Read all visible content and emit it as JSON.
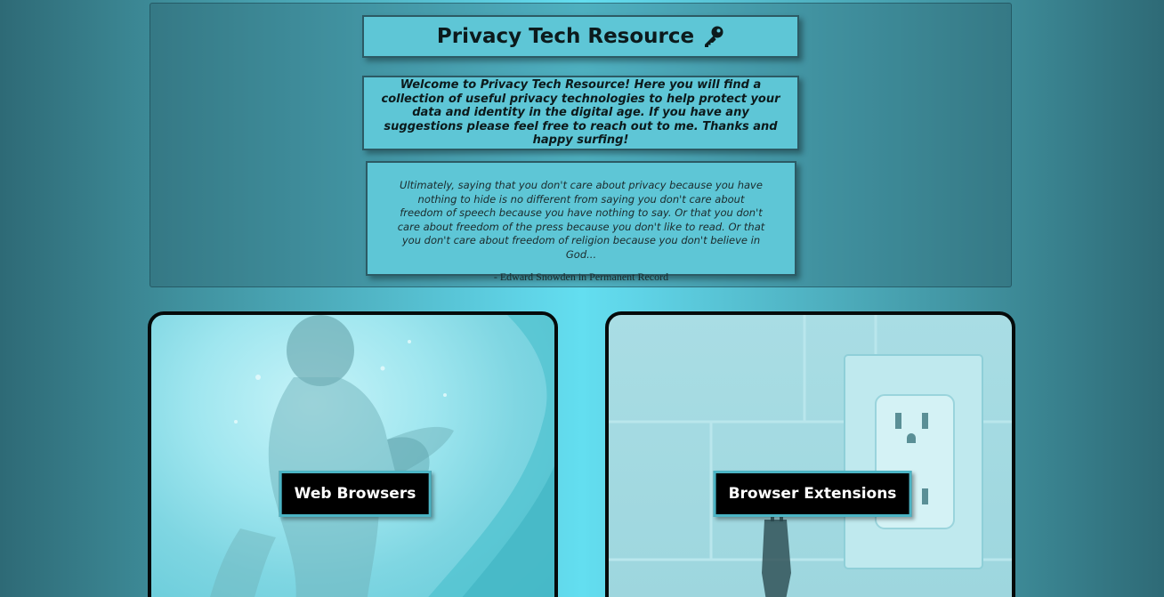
{
  "header": {
    "title": "Privacy Tech Resource",
    "title_icon": "key-icon",
    "welcome": "Welcome to Privacy Tech Resource! Here you will find a collection of useful privacy technologies to help protect your data and identity in the digital age. If you have any suggestions please feel free to reach out to me. Thanks and happy surfing!",
    "quote": "Ultimately, saying that you don't care about privacy because you have nothing to hide is no different from saying you don't care about freedom of speech because you have nothing to say. Or that you don't care about freedom of the press because you don't like to read. Or that you don't care about freedom of religion because you don't believe in God...",
    "quote_attribution": "- Edward Snowden in Permanent Record"
  },
  "cards": [
    {
      "label": "Web Browsers",
      "image": "surfer-in-wave"
    },
    {
      "label": "Browser Extensions",
      "image": "wall-outlet-with-plug"
    }
  ],
  "colors": {
    "accent": "#5ec6d6",
    "button_border": "#4bb4c4",
    "button_bg": "#000000"
  }
}
